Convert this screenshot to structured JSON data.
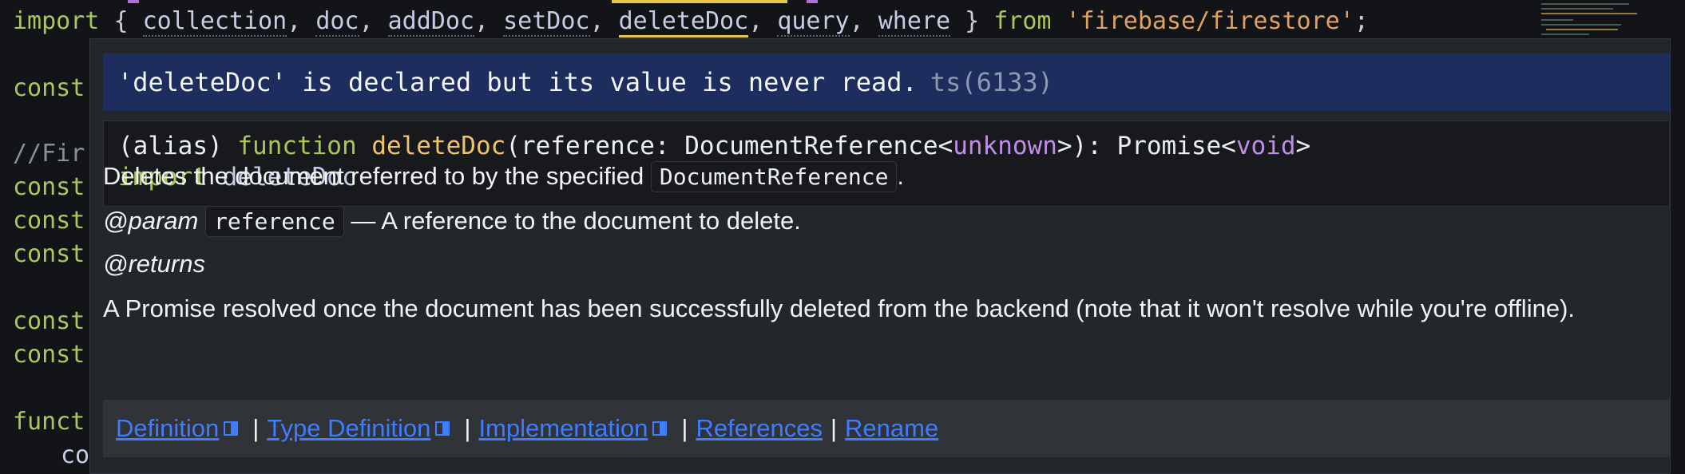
{
  "editor": {
    "import_line": {
      "keyword": "import",
      "open_brace": "{",
      "names": [
        "collection",
        "doc",
        "addDoc",
        "setDoc",
        "deleteDoc",
        "query",
        "where"
      ],
      "close_brace": "}",
      "from": "from",
      "module": "'firebase/firestore'",
      "semicolon": ";"
    },
    "partial_lines": [
      "const",
      "//Fir",
      "const",
      "const",
      "const",
      "const",
      "const",
      "funct",
      "co"
    ]
  },
  "hover": {
    "diagnostic": {
      "message": "'deleteDoc' is declared but its value is never read.",
      "code": "ts(6133)"
    },
    "signature": {
      "alias": "(alias)",
      "function_kw": "function",
      "name": "deleteDoc",
      "params_prefix": "(reference: DocumentReference<",
      "type_arg": "unknown",
      "params_suffix": ">): Promise<",
      "return_type": "void",
      "close": ">",
      "import_kw": "import",
      "import_name": "deleteDoc"
    },
    "doc": {
      "summary_text": "Deletes the document referred to by the specified",
      "summary_code": "DocumentReference",
      "summary_end": ".",
      "param_tag": "@param",
      "param_name": "reference",
      "param_desc": "— A reference to the document to delete.",
      "returns_tag": "@returns",
      "returns_desc": "A Promise resolved once the document has been successfully deleted from the backend (note that it won't resolve while you're offline)."
    },
    "links": {
      "definition": "Definition",
      "type_definition": "Type Definition",
      "implementation": "Implementation",
      "references": "References",
      "rename": "Rename",
      "separator": "|"
    }
  },
  "colors": {
    "background": "#121417",
    "diagnostic_bg": "#1c2d5e",
    "link": "#3f7cff",
    "keyword": "#a8c957",
    "string": "#e0a25f"
  }
}
